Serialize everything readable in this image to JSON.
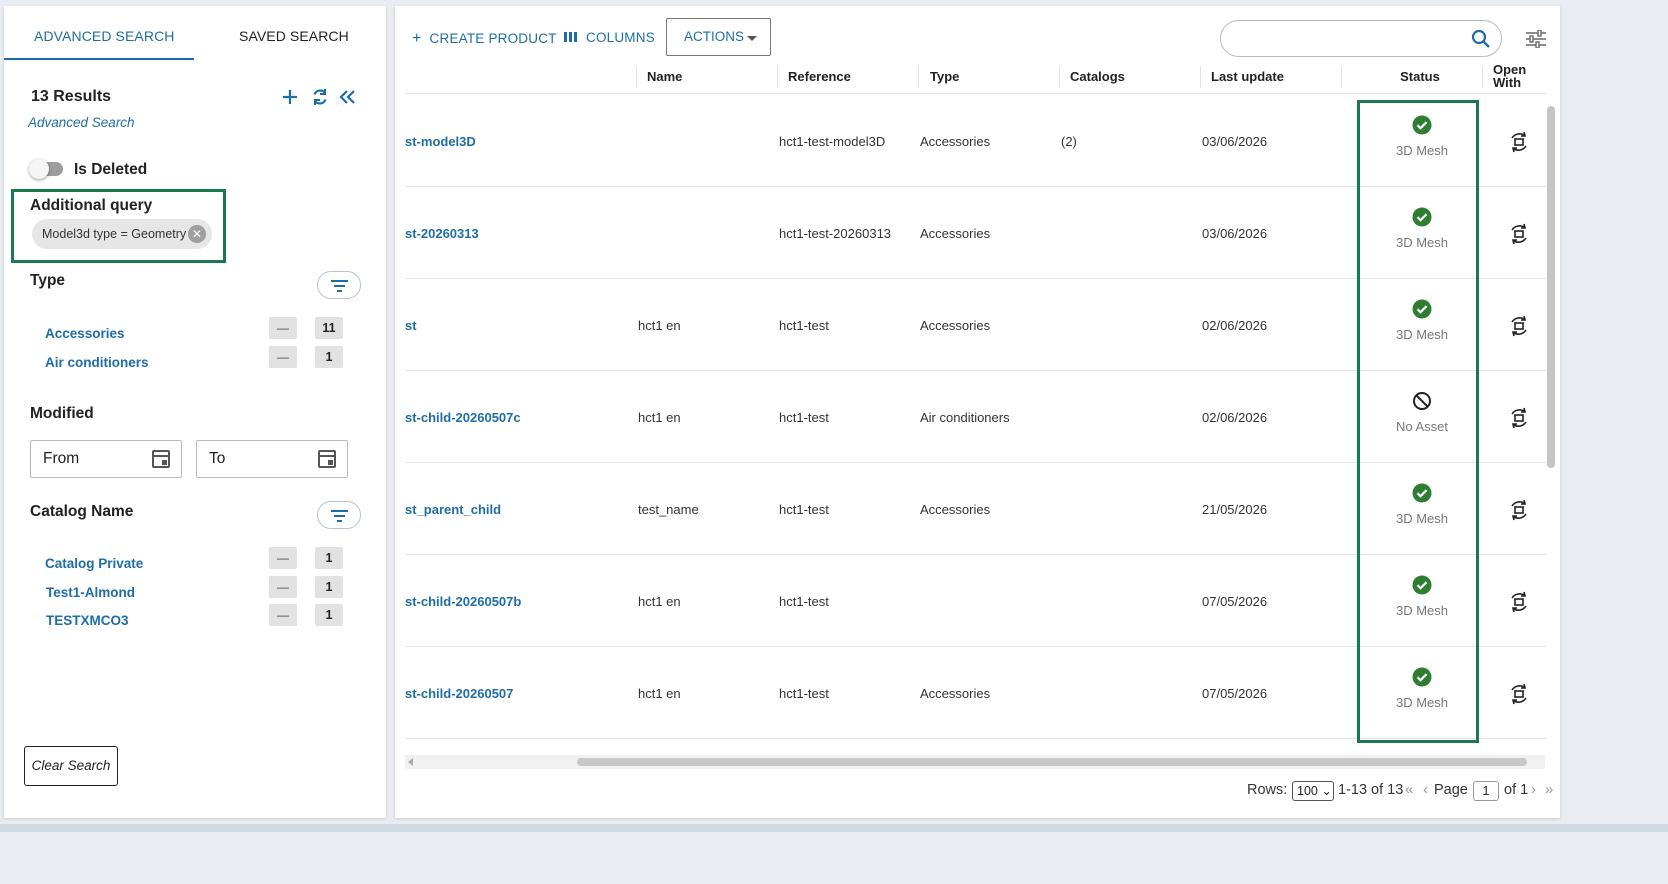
{
  "left_panel": {
    "tabs": [
      "ADVANCED SEARCH",
      "SAVED SEARCH"
    ],
    "results": "13 Results",
    "advanced_link": "Advanced Search",
    "is_deleted_label": "Is Deleted",
    "additional_query": {
      "title": "Additional query",
      "chip": "Model3d type = Geometry"
    },
    "type_section": {
      "title": "Type",
      "items": [
        {
          "label": "Accessories",
          "count": "11"
        },
        {
          "label": "Air conditioners",
          "count": "1"
        }
      ]
    },
    "modified": {
      "title": "Modified",
      "from": "From",
      "to": "To"
    },
    "catalog_section": {
      "title": "Catalog Name",
      "items": [
        {
          "label": "Catalog Private",
          "count": "1"
        },
        {
          "label": "Test1-Almond",
          "count": "1"
        },
        {
          "label": "TESTXMCO3",
          "count": "1"
        }
      ]
    },
    "minus_symbol": "—",
    "clear_button": "Clear Search"
  },
  "toolbar": {
    "create_product": "CREATE PRODUCT",
    "columns": "COLUMNS",
    "actions": "ACTIONS",
    "search_placeholder": ""
  },
  "table": {
    "headers": {
      "name": "Name",
      "reference": "Reference",
      "type": "Type",
      "catalogs": "Catalogs",
      "last_update": "Last update",
      "status": "Status",
      "open_with": "Open With"
    },
    "rows": [
      {
        "id": "st-model3D",
        "name": "",
        "reference": "hct1-test-model3D",
        "type": "Accessories",
        "catalogs": "(2)",
        "last_update": "03/06/2026",
        "status": "3D Mesh",
        "status_kind": "ok"
      },
      {
        "id": "st-20260313",
        "name": "",
        "reference": "hct1-test-20260313",
        "type": "Accessories",
        "catalogs": "",
        "last_update": "03/06/2026",
        "status": "3D Mesh",
        "status_kind": "ok"
      },
      {
        "id": "st",
        "name": "hct1 en",
        "reference": "hct1-test",
        "type": "Accessories",
        "catalogs": "",
        "last_update": "02/06/2026",
        "status": "3D Mesh",
        "status_kind": "ok"
      },
      {
        "id": "st-child-20260507c",
        "name": "hct1 en",
        "reference": "hct1-test",
        "type": "Air conditioners",
        "catalogs": "",
        "last_update": "02/06/2026",
        "status": "No Asset",
        "status_kind": "none"
      },
      {
        "id": "st_parent_child",
        "name": "test_name",
        "reference": "hct1-test",
        "type": "Accessories",
        "catalogs": "",
        "last_update": "21/05/2026",
        "status": "3D Mesh",
        "status_kind": "ok"
      },
      {
        "id": "st-child-20260507b",
        "name": "hct1 en",
        "reference": "hct1-test",
        "type": "",
        "catalogs": "",
        "last_update": "07/05/2026",
        "status": "3D Mesh",
        "status_kind": "ok"
      },
      {
        "id": "st-child-20260507",
        "name": "hct1 en",
        "reference": "hct1-test",
        "type": "Accessories",
        "catalogs": "",
        "last_update": "07/05/2026",
        "status": "3D Mesh",
        "status_kind": "ok"
      }
    ]
  },
  "pagination": {
    "rows_label": "Rows:",
    "rows_value": "100",
    "range": "1-13 of 13",
    "page_label": "Page",
    "page_value": "1",
    "of_pages": "of 1"
  },
  "colors": {
    "accent": "#1f6da8",
    "highlight": "#1a7a4f",
    "ok_green": "#2e7d32"
  }
}
